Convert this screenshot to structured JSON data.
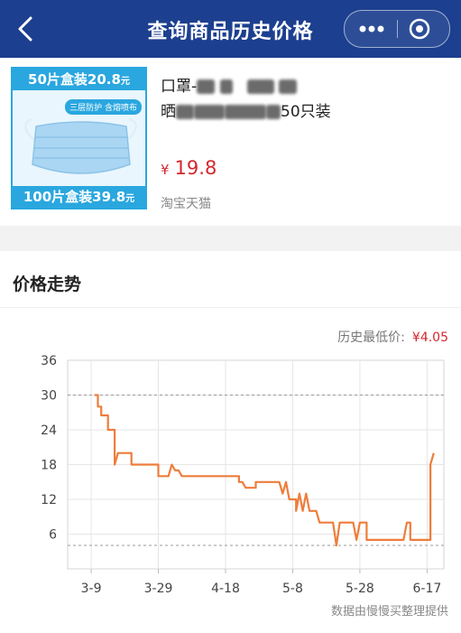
{
  "nav": {
    "title": "查询商品历史价格",
    "icons": [
      "back-chevron-icon",
      "more-icon",
      "target-icon"
    ]
  },
  "product": {
    "thumb_top": "50片盒装20.8",
    "thumb_top_unit": "元",
    "thumb_bottom": "100片盒装39.8",
    "thumb_bottom_unit": "元",
    "thumb_tag": "三层防护 含熔喷布",
    "title_line1": "口罩-",
    "title_line2_start": "晒",
    "title_line2_end": "50只装",
    "price_symbol": "¥",
    "price": "19.8",
    "platform": "淘宝天猫"
  },
  "trend": {
    "title": "价格走势",
    "lowest_label": "历史最低价:",
    "lowest_value": "¥4.05",
    "credit": "数据由慢慢买整理提供"
  },
  "colors": {
    "nav_bg": "#1c3f8f",
    "price_red": "#d4272e",
    "line": "#ee7d3b",
    "thumb_blue": "#2aa7df"
  },
  "chart_data": {
    "type": "line",
    "x_tick_labels": [
      "3-9",
      "3-29",
      "4-18",
      "5-8",
      "5-28",
      "6-17"
    ],
    "x_ticks_day": [
      0,
      20,
      40,
      60,
      80,
      100
    ],
    "xlim_day": [
      -7,
      105
    ],
    "ylim": [
      0,
      36
    ],
    "y_ticks": [
      6,
      12,
      18,
      24,
      30,
      36
    ],
    "reference_lines": [
      30,
      4.05
    ],
    "grid": true,
    "series": [
      {
        "x_day": [
          1,
          2,
          2,
          3,
          3,
          4,
          4,
          5,
          5,
          6,
          6,
          7,
          7,
          8,
          12,
          12,
          15,
          15,
          16,
          16,
          17,
          17,
          18,
          18,
          20,
          20,
          22,
          22,
          23,
          24,
          24,
          25,
          26,
          27,
          28,
          28,
          33,
          33,
          38,
          38,
          44,
          44,
          45,
          46,
          46,
          49,
          49,
          56,
          57,
          58,
          58,
          59,
          59,
          60,
          61,
          61,
          62,
          63,
          63,
          64,
          64,
          65,
          66,
          66,
          67,
          68,
          69,
          69,
          70,
          72,
          72,
          73,
          74,
          75,
          75,
          76,
          76,
          78,
          79,
          80,
          81,
          82,
          82,
          83,
          83,
          84,
          85,
          86,
          86,
          90,
          91,
          93,
          93,
          94,
          95,
          95,
          96,
          98,
          99,
          100,
          100,
          101,
          101,
          102
        ],
        "y": [
          30,
          30,
          28,
          28,
          26.5,
          26.5,
          26.5,
          26.5,
          24,
          24,
          24,
          24,
          18,
          20,
          20,
          18,
          18,
          18,
          18,
          18,
          18,
          18,
          18,
          18,
          18,
          16,
          16,
          16,
          16,
          18,
          18,
          17,
          17,
          16,
          16,
          16,
          16,
          16,
          16,
          16,
          16,
          15,
          15,
          14,
          14,
          14,
          15,
          15,
          13,
          15,
          15,
          12,
          12,
          12,
          12,
          10,
          13,
          10,
          10,
          13,
          13,
          10,
          10,
          10,
          10,
          8,
          8,
          8,
          8,
          8,
          8,
          4.05,
          8,
          8,
          8,
          8,
          8,
          8,
          5,
          8,
          8,
          8,
          5,
          5,
          5,
          5,
          5,
          5,
          5,
          5,
          5,
          5,
          5,
          8,
          8,
          5,
          5,
          5,
          5,
          5,
          5,
          5,
          18,
          20
        ]
      }
    ]
  }
}
